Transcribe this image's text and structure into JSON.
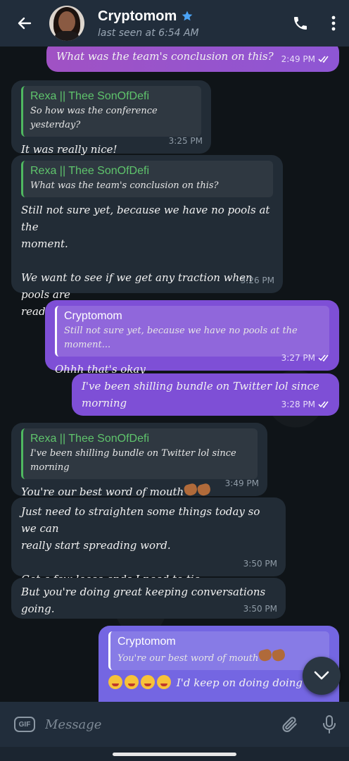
{
  "header": {
    "contact_name": "Cryptomom",
    "last_seen": "last seen at 6:54 AM"
  },
  "messages": [
    {
      "id": "m0",
      "direction": "out",
      "text": "What was the team's conclusion on this?",
      "time": "2:49 PM",
      "read": true
    },
    {
      "id": "m1",
      "direction": "in",
      "quote_name": "Rexa || Thee SonOfDefi",
      "quote_text": "So how was the conference yesterday?",
      "text": "It was really nice!",
      "time": "3:25 PM"
    },
    {
      "id": "m2",
      "direction": "in",
      "quote_name": "Rexa || Thee SonOfDefi",
      "quote_text": "What was the team's conclusion on this?",
      "text_lines": [
        "Still not sure yet, because we have no pools at the",
        "moment.",
        "",
        "We want to see if we get any traction when pools are",
        "ready."
      ],
      "time": "3:26 PM"
    },
    {
      "id": "m3",
      "direction": "out",
      "quote_name": "Cryptomom",
      "quote_text": "Still not sure yet, because we have no pools at the moment...",
      "text": "Ohhh that's okay",
      "time": "3:27 PM",
      "read": true
    },
    {
      "id": "m4",
      "direction": "out",
      "text": "I've been shilling bundle on Twitter lol since morning",
      "time": "3:28 PM",
      "read": true
    },
    {
      "id": "m5",
      "direction": "in",
      "quote_name": "Rexa || Thee SonOfDefi",
      "quote_text": "I've been shilling bundle on Twitter lol since morning",
      "text": "You're our best word of mouth",
      "time": "3:49 PM"
    },
    {
      "id": "m6",
      "direction": "in",
      "text_lines": [
        "Just need to straighten some things today so we can",
        "really start spreading word.",
        "",
        "Got a few loose ends I need to tie."
      ],
      "time": "3:50 PM"
    },
    {
      "id": "m7",
      "direction": "in",
      "text": "But you're doing great keeping conversations going.",
      "time": "3:50 PM"
    },
    {
      "id": "m8",
      "direction": "out",
      "quote_name": "Cryptomom",
      "quote_text": "You're our best word of mouth",
      "text": "I'd keep on doing doing my"
    }
  ],
  "composer": {
    "gif_label": "GIF",
    "placeholder": "Message"
  },
  "colors": {
    "header_bg": "#212d3b",
    "incoming_bubble": "#222c36",
    "outgoing_bubble": "#7e4fd6",
    "quote_name_green": "#5fc46c",
    "star_blue": "#4ba3f5"
  },
  "icons": [
    "back-arrow-icon",
    "verified-star-icon",
    "phone-icon",
    "more-vertical-icon",
    "double-check-icon",
    "chevron-down-icon",
    "gif-icon",
    "attach-icon",
    "microphone-icon"
  ]
}
